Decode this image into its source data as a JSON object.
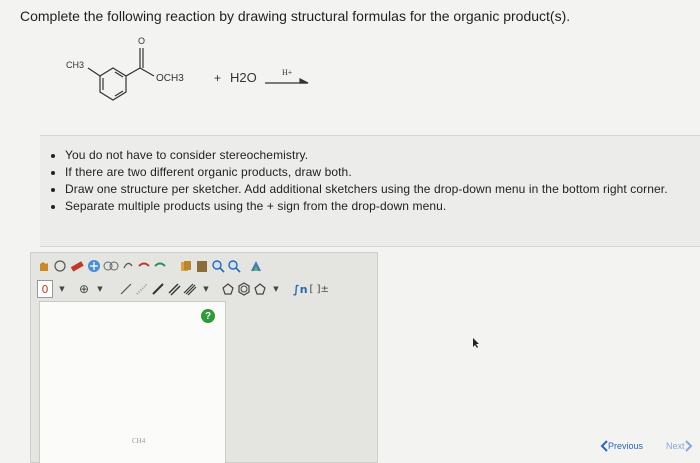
{
  "question": "Complete the following reaction by drawing structural formulas for the organic product(s).",
  "reaction": {
    "methyl_label": "CH3",
    "carbonyl_o": "O",
    "ester_label": "OCH3",
    "plus": "+",
    "water": "H2O",
    "catalyst": "H+"
  },
  "instructions": [
    "You do not have to consider stereochemistry.",
    "If there are two different organic products, draw both.",
    "Draw one structure per sketcher. Add additional sketchers using the drop-down menu in the bottom right corner.",
    "Separate multiple products using the + sign from the drop-down menu."
  ],
  "sketcher": {
    "charge_label": "0",
    "plus_circle": "⊕",
    "template_fn": "∫n",
    "brackets": "[ ]±",
    "canvas_label": "CH4",
    "help": "?"
  },
  "nav": {
    "previous": "Previous",
    "next": "Next"
  }
}
